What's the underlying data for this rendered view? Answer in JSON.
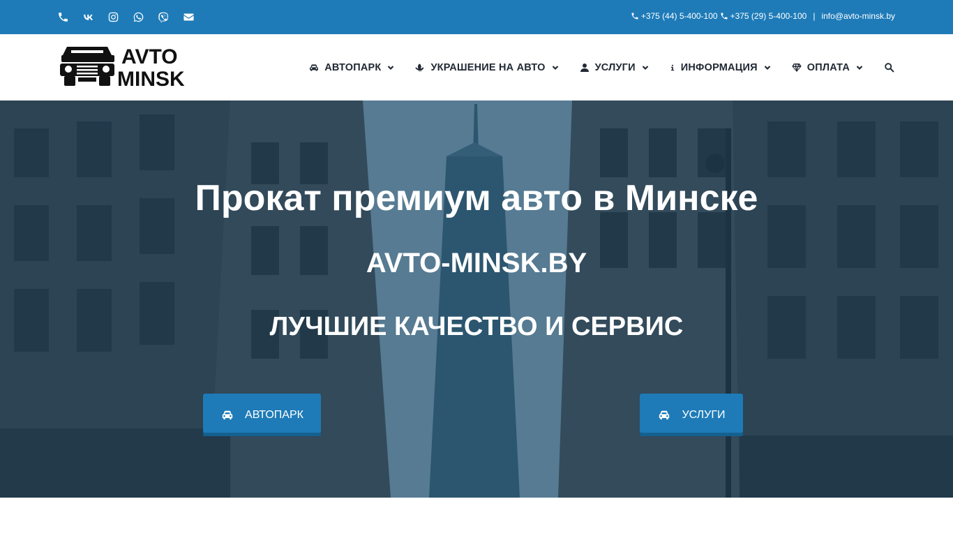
{
  "topbar": {
    "social": [
      {
        "icon": "phone-icon"
      },
      {
        "icon": "vk-icon"
      },
      {
        "icon": "instagram-icon"
      },
      {
        "icon": "whatsapp-icon"
      },
      {
        "icon": "viber-icon"
      },
      {
        "icon": "envelope-icon"
      }
    ],
    "phone1": "+375 (44) 5-400-100",
    "phone2": "+375 (29) 5-400-100",
    "separator": "|",
    "email": "info@avto-minsk.by"
  },
  "header": {
    "logo_line1": "AVTO",
    "logo_line2": "MINSK",
    "nav": [
      {
        "label": "АВТОПАРК",
        "icon": "car-icon"
      },
      {
        "label": "УКРАШЕНИЕ НА АВТО",
        "icon": "flower-icon"
      },
      {
        "label": "УСЛУГИ",
        "icon": "user-icon"
      },
      {
        "label": "ИНФОРМАЦИЯ",
        "icon": "info-icon"
      },
      {
        "label": "ОПЛАТА",
        "icon": "diamond-icon"
      }
    ]
  },
  "hero": {
    "title": "Прокат премиум авто в Минске",
    "subtitle": "AVTO-MINSK.BY",
    "tagline": "ЛУЧШИЕ КАЧЕСТВО И СЕРВИС",
    "btn_fleet": "АВТОПАРК",
    "btn_services": "УСЛУГИ"
  },
  "colors": {
    "accent": "#1e7bb8",
    "nav_text": "#212934"
  }
}
